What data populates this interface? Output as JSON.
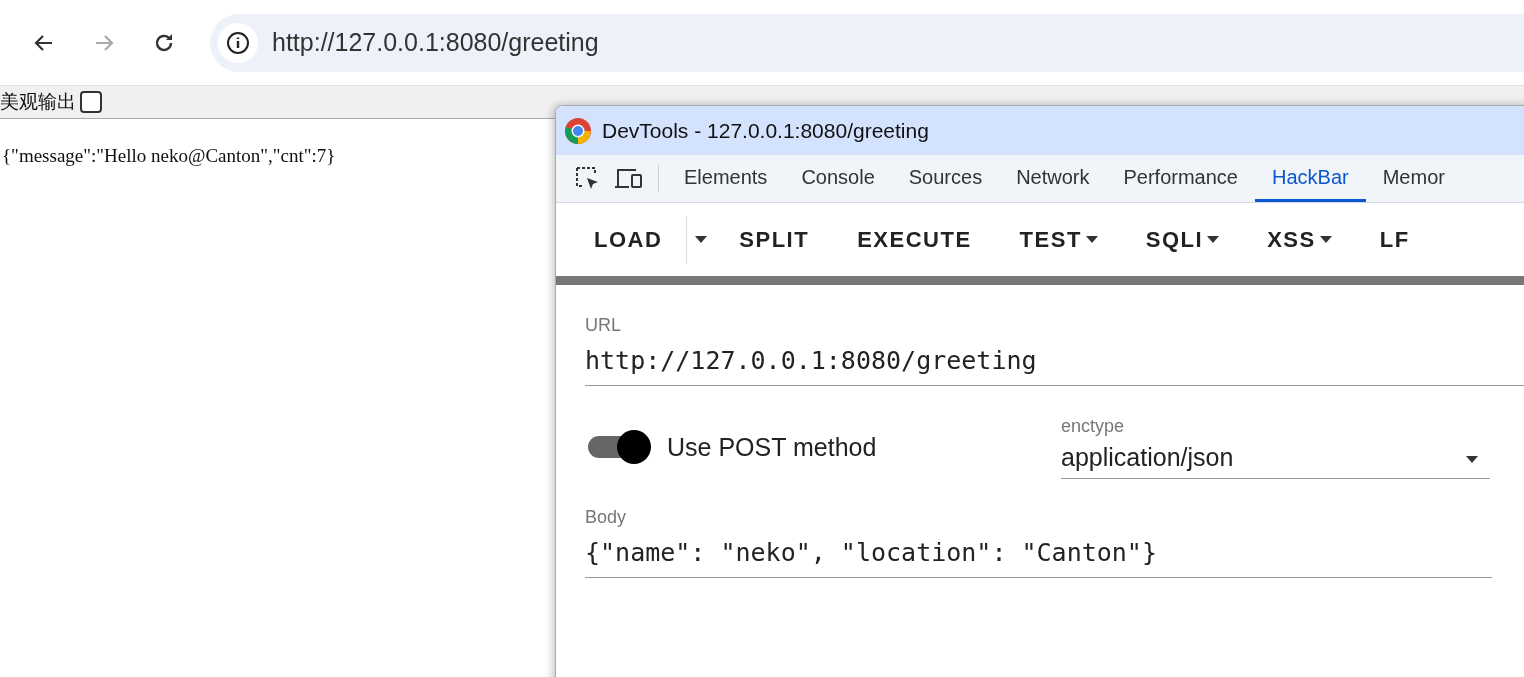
{
  "browser": {
    "address": "http://127.0.0.1:8080/greeting",
    "back_enabled": true,
    "forward_enabled": false
  },
  "page": {
    "pretty_print": {
      "label": "美观输出",
      "checked": false
    },
    "output": "{\"message\":\"Hello neko@Canton\",\"cnt\":7}"
  },
  "devtools": {
    "title": "DevTools - 127.0.0.1:8080/greeting",
    "tabs": [
      {
        "label": "Elements",
        "selected": false
      },
      {
        "label": "Console",
        "selected": false
      },
      {
        "label": "Sources",
        "selected": false
      },
      {
        "label": "Network",
        "selected": false
      },
      {
        "label": "Performance",
        "selected": false
      },
      {
        "label": "HackBar",
        "selected": true
      },
      {
        "label": "Memor",
        "selected": false
      }
    ],
    "toolbar": [
      {
        "label": "LOAD",
        "kind": "split"
      },
      {
        "label": "SPLIT",
        "kind": "button"
      },
      {
        "label": "EXECUTE",
        "kind": "button"
      },
      {
        "label": "TEST",
        "kind": "menu"
      },
      {
        "label": "SQLI",
        "kind": "menu"
      },
      {
        "label": "XSS",
        "kind": "menu"
      },
      {
        "label": "LF",
        "kind": "button"
      }
    ],
    "url": {
      "label": "URL",
      "value": "http://127.0.0.1:8080/greeting"
    },
    "post": {
      "label": "Use POST method",
      "on": true
    },
    "enctype": {
      "label": "enctype",
      "value": "application/json"
    },
    "body": {
      "label": "Body",
      "value": "{\"name\": \"neko\", \"location\": \"Canton\"}"
    }
  }
}
